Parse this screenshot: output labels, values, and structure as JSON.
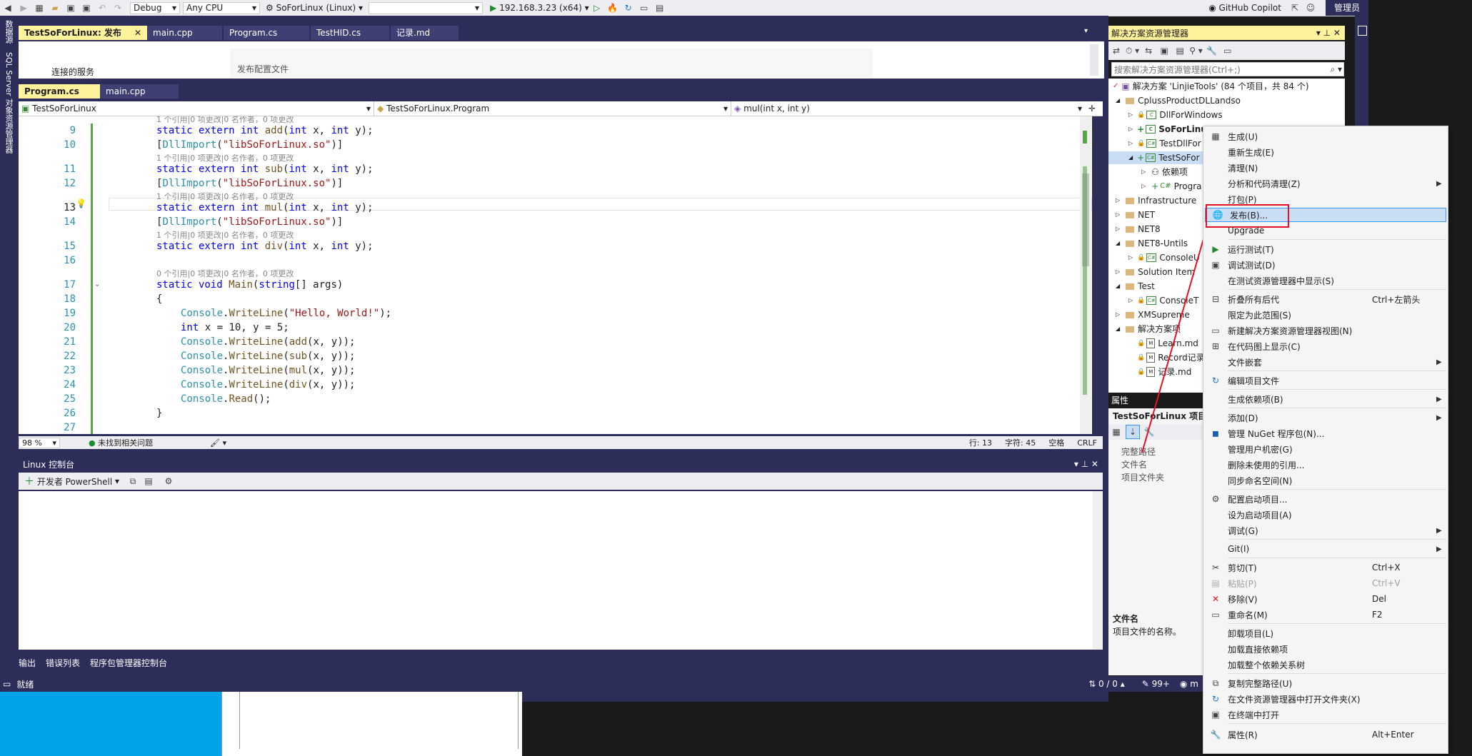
{
  "toolbar": {
    "config": "Debug",
    "platform": "Any CPU",
    "startup_project": "SoForLinux (Linux)",
    "target": "",
    "run_target": "192.168.3.23 (x64)",
    "copilot": "GitHub Copilot",
    "admin": "管理员"
  },
  "left_strip": {
    "tab1": "数据源",
    "tab2": "SQL Server 对象资源管理器"
  },
  "doc_tabs": [
    {
      "label": "TestSoForLinux: 发布",
      "active": true
    },
    {
      "label": "main.cpp"
    },
    {
      "label": "Program.cs"
    },
    {
      "label": "TestHID.cs"
    },
    {
      "label": "记录.md"
    }
  ],
  "publish_page": {
    "connected_services": "连接的服务",
    "publish_config": "发布配置文件"
  },
  "editor_tabs": [
    {
      "label": "Program.cs",
      "active": true
    },
    {
      "label": "main.cpp"
    }
  ],
  "nav": {
    "project": "TestSoForLinux",
    "class": "TestSoForLinux.Program",
    "member": "mul(int x, int y)"
  },
  "code": {
    "lens_top": "1 个引用|0 项更改|0 名作者，0 项更改",
    "lens": "1 个引用|0 项更改|0 名作者，0 项更改",
    "lens_main": "0 个引用|0 项更改|0 名作者，0 项更改",
    "line_numbers": [
      "9",
      "10",
      "11",
      "12",
      "13",
      "14",
      "15",
      "16",
      "17",
      "18",
      "19",
      "20",
      "21",
      "22",
      "23",
      "24",
      "25",
      "26",
      "27"
    ]
  },
  "editor_status": {
    "zoom": "98 %",
    "issues": "未找到相关问题",
    "line": "行: 13",
    "char": "字符: 45",
    "space": "空格",
    "eol": "CRLF"
  },
  "linux_console": {
    "title": "Linux 控制台",
    "dev_shell": "开发者 PowerShell"
  },
  "bottom_tabs": [
    "输出",
    "错误列表",
    "程序包管理器控制台"
  ],
  "status_bar": {
    "ready": "就绪",
    "changes": "0 / 0",
    "count": "99+",
    "extra": "m"
  },
  "solution_explorer": {
    "title": "解决方案资源管理器",
    "search_placeholder": "搜索解决方案资源管理器(Ctrl+;)",
    "solution": "解决方案 'LinjieTools' (84 个项目，共 84 个)",
    "items": [
      "CplussProductDLLandso",
      "DllForWindows",
      "SoForLinu",
      "TestDllFor",
      "TestSoFor",
      "依赖项",
      "Progra",
      "Infrastructure",
      "NET",
      "NET8",
      "NET8-Untils",
      "ConsoleU",
      "Solution Item",
      "Test",
      "ConsoleT",
      "XMSupreme",
      "解决方案项",
      "Learn.md",
      "Record记录",
      "记录.md"
    ]
  },
  "properties": {
    "title": "属性",
    "object": "TestSoForLinux 项目",
    "rows": [
      "完整路径",
      "文件名",
      "项目文件夹"
    ],
    "desc_title": "文件名",
    "desc_text": "项目文件的名称。"
  },
  "context_menu": {
    "items": [
      {
        "label": "生成(U)"
      },
      {
        "label": "重新生成(E)"
      },
      {
        "label": "清理(N)"
      },
      {
        "label": "分析和代码清理(Z)",
        "submenu": true
      },
      {
        "label": "打包(P)"
      },
      {
        "label": "发布(B)...",
        "highlight": true
      },
      {
        "label": "Upgrade"
      },
      {
        "label": "运行测试(T)"
      },
      {
        "label": "调试测试(D)"
      },
      {
        "label": "在测试资源管理器中显示(S)"
      },
      {
        "label": "折叠所有后代",
        "shortcut": "Ctrl+左箭头"
      },
      {
        "label": "限定为此范围(S)"
      },
      {
        "label": "新建解决方案资源管理器视图(N)"
      },
      {
        "label": "在代码图上显示(C)"
      },
      {
        "label": "文件嵌套",
        "submenu": true
      },
      {
        "label": "编辑项目文件"
      },
      {
        "label": "生成依赖项(B)",
        "submenu": true
      },
      {
        "label": "添加(D)",
        "submenu": true
      },
      {
        "label": "管理 NuGet 程序包(N)..."
      },
      {
        "label": "管理用户机密(G)"
      },
      {
        "label": "删除未使用的引用..."
      },
      {
        "label": "同步命名空间(N)"
      },
      {
        "label": "配置启动项目..."
      },
      {
        "label": "设为启动项目(A)"
      },
      {
        "label": "调试(G)",
        "submenu": true
      },
      {
        "label": "Git(I)",
        "submenu": true
      },
      {
        "label": "剪切(T)",
        "shortcut": "Ctrl+X"
      },
      {
        "label": "粘贴(P)",
        "shortcut": "Ctrl+V",
        "disabled": true
      },
      {
        "label": "移除(V)",
        "shortcut": "Del"
      },
      {
        "label": "重命名(M)",
        "shortcut": "F2"
      },
      {
        "label": "卸载项目(L)"
      },
      {
        "label": "加载直接依赖项"
      },
      {
        "label": "加载整个依赖关系树"
      },
      {
        "label": "复制完整路径(U)"
      },
      {
        "label": "在文件资源管理器中打开文件夹(X)"
      },
      {
        "label": "在终端中打开"
      },
      {
        "label": "属性(R)",
        "shortcut": "Alt+Enter"
      }
    ]
  },
  "colors": {
    "vs_navy": "#2d2d5a",
    "tab_active": "#fff29d",
    "menu_highlight": "#c9def5",
    "red_box": "#e81123"
  }
}
